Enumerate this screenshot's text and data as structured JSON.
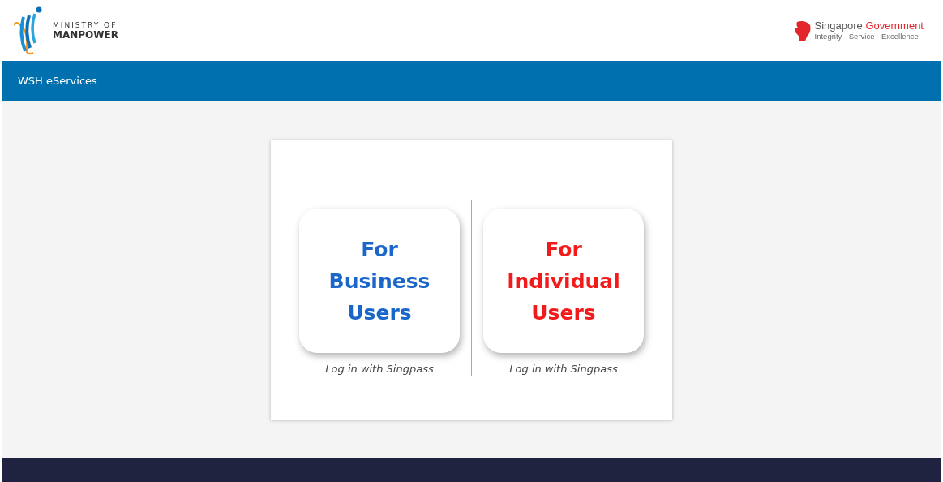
{
  "header": {
    "logo": {
      "line_1": "MINISTRY OF",
      "line_2": "MANPOWER"
    },
    "government": {
      "name_1": "Singapore",
      "name_2": "Government",
      "tagline": "Integrity · Service · Excellence"
    }
  },
  "nav_bar": {
    "title": "WSH eServices"
  },
  "options": [
    {
      "title": "For Business Users",
      "color": "#1a66c9",
      "caption": "Log in with Singpass"
    },
    {
      "title": "For Individual Users",
      "color": "#f21b1b",
      "caption": "Log in with Singpass"
    }
  ]
}
